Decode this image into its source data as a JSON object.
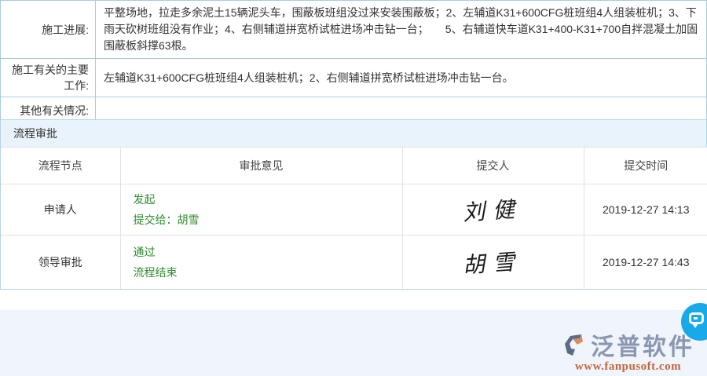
{
  "info_table": {
    "rows": [
      {
        "label": "施工进展:",
        "value": "平整场地，拉走多余泥土15辆泥头车，围蔽板班组没过来安装围蔽板；2、左辅道K31+600CFG桩班组4人组装桩机；3、下雨天砍树班组没有作业；4、右侧辅道拼宽桥试桩进场冲击钻一台；　　5、右辅道快车道K31+400-K31+700自拌混凝土加固围蔽板斜撑63根。"
      },
      {
        "label": "施工有关的主要工作:",
        "value": "左辅道K31+600CFG桩班组4人组装桩机；2、右侧辅道拼宽桥试桩进场冲击钻一台。"
      },
      {
        "label": "其他有关情况:",
        "value": ""
      }
    ]
  },
  "approval": {
    "section_title": "流程审批",
    "headers": [
      "流程节点",
      "审批意见",
      "提交人",
      "提交时间"
    ],
    "rows": [
      {
        "node": "申请人",
        "opinion_line1": "发起",
        "opinion_line2": "提交给：胡雪",
        "submitter_signature": "刘健",
        "time": "2019-12-27 14:13"
      },
      {
        "node": "领导审批",
        "opinion_line1": "通过",
        "opinion_line2": "流程结束",
        "submitter_signature": "胡雪",
        "time": "2019-12-27 14:43"
      }
    ]
  },
  "footer": {
    "brand_name": "泛普软件",
    "brand_url": "www.fanpusoft.com"
  },
  "colors": {
    "info_table_border": "#a9cbe2",
    "panel_header_bg": "#e9f3fb",
    "status_green": "#2e8b2e",
    "footer_bg": "#f0f4fb",
    "brand_gray_blue": "#8b96b2",
    "brand_orange": "#c2663e",
    "chat_button_blue": "#18a9e8"
  }
}
